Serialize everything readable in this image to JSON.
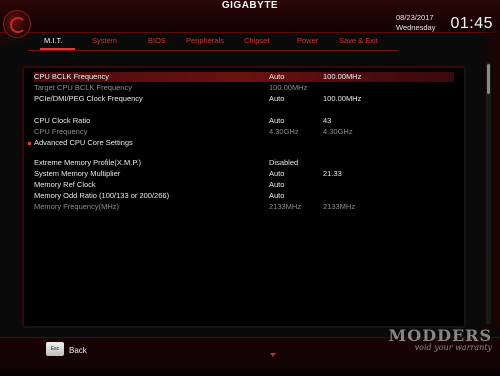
{
  "header": {
    "brand": "GIGABYTE",
    "date": "08/23/2017",
    "weekday": "Wednesday",
    "time": "01:45"
  },
  "tabs": [
    {
      "label": "M.I.T.",
      "active": true
    },
    {
      "label": "System",
      "active": false
    },
    {
      "label": "BIOS",
      "active": false
    },
    {
      "label": "Peripherals",
      "active": false
    },
    {
      "label": "Chipset",
      "active": false
    },
    {
      "label": "Power",
      "active": false
    },
    {
      "label": "Save & Exit",
      "active": false
    }
  ],
  "settings": [
    {
      "label": "CPU BCLK Frequency",
      "value": "Auto",
      "current": "100.00MHz",
      "state": "selected"
    },
    {
      "label": "Target CPU BCLK Frequency",
      "value": "100.00MHz",
      "current": "",
      "state": "dim"
    },
    {
      "label": "PCIe/DMI/PEG Clock Frequency",
      "value": "Auto",
      "current": "100.00MHz",
      "state": "normal"
    },
    {
      "label": "CPU Clock Ratio",
      "value": "Auto",
      "current": "43",
      "state": "normal"
    },
    {
      "label": "CPU Frequency",
      "value": "4.30GHz",
      "current": "4.30GHz",
      "state": "dim"
    },
    {
      "label": "Advanced CPU Core Settings",
      "value": "",
      "current": "",
      "state": "submenu"
    },
    {
      "label": "Extreme Memory Profile(X.M.P.)",
      "value": "Disabled",
      "current": "",
      "state": "normal"
    },
    {
      "label": "System Memory Multiplier",
      "value": "Auto",
      "current": "21.33",
      "state": "normal"
    },
    {
      "label": "Memory Ref Clock",
      "value": "Auto",
      "current": "",
      "state": "normal"
    },
    {
      "label": "Memory Odd Ratio (100/133 or 200/266)",
      "value": "Auto",
      "current": "",
      "state": "normal"
    },
    {
      "label": "Memory Frequency(MHz)",
      "value": "2133MHz",
      "current": "2133MHz",
      "state": "dim"
    }
  ],
  "footer": {
    "esc_key": "Esc",
    "back_label": "Back"
  },
  "watermark": {
    "line1": "MODDERS",
    "line2": "void your warranty"
  },
  "colors": {
    "accent": "#e53935",
    "selected_row": "#6a1111",
    "dim_text": "#8c8c8c"
  }
}
